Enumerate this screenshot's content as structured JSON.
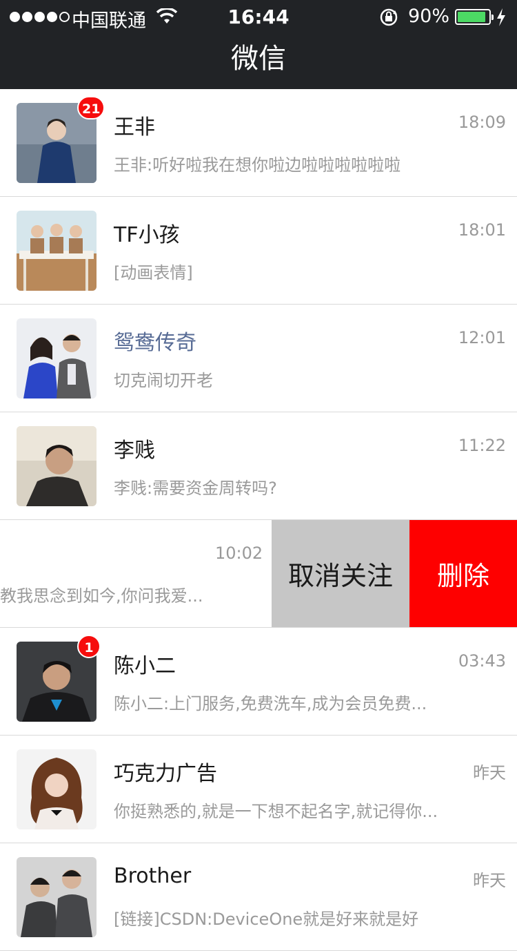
{
  "status_bar": {
    "carrier": "中国联通",
    "time": "16:44",
    "battery_percent": "90%",
    "battery_level": 0.9,
    "signal_bars": 4,
    "signal_max": 5
  },
  "nav": {
    "title": "微信"
  },
  "colors": {
    "bar": "#212326",
    "badge": "#f60d0d",
    "delete": "#fe0000",
    "unfollow": "#c6c6c6",
    "link_name": "#576b95"
  },
  "conversations": [
    {
      "name": "王非",
      "time": "18:09",
      "preview": "王非:听好啦我在想你啦边啦啦啦啦啦啦",
      "badge": "21"
    },
    {
      "name": "TF小孩",
      "time": "18:01",
      "preview": "[动画表情]"
    },
    {
      "name": "鸳鸯传奇",
      "time": "12:01",
      "preview": "切克闹切开老"
    },
    {
      "name": "李贱",
      "time": "11:22",
      "preview": "李贱:需要资金周转吗?"
    },
    {
      "time": "10:02",
      "preview": "教我思念到如今,你问我爱...",
      "actions": {
        "unfollow": "取消关注",
        "delete": "删除"
      }
    },
    {
      "name": "陈小二",
      "time": "03:43",
      "preview": "陈小二:上门服务,免费洗车,成为会员免费...",
      "badge": "1"
    },
    {
      "name": "巧克力广告",
      "time": "昨天",
      "preview": "你挺熟悉的,就是一下想不起名字,就记得你..."
    },
    {
      "name": "Brother",
      "time": "昨天",
      "preview": "[链接]CSDN:DeviceOne就是好来就是好"
    }
  ]
}
